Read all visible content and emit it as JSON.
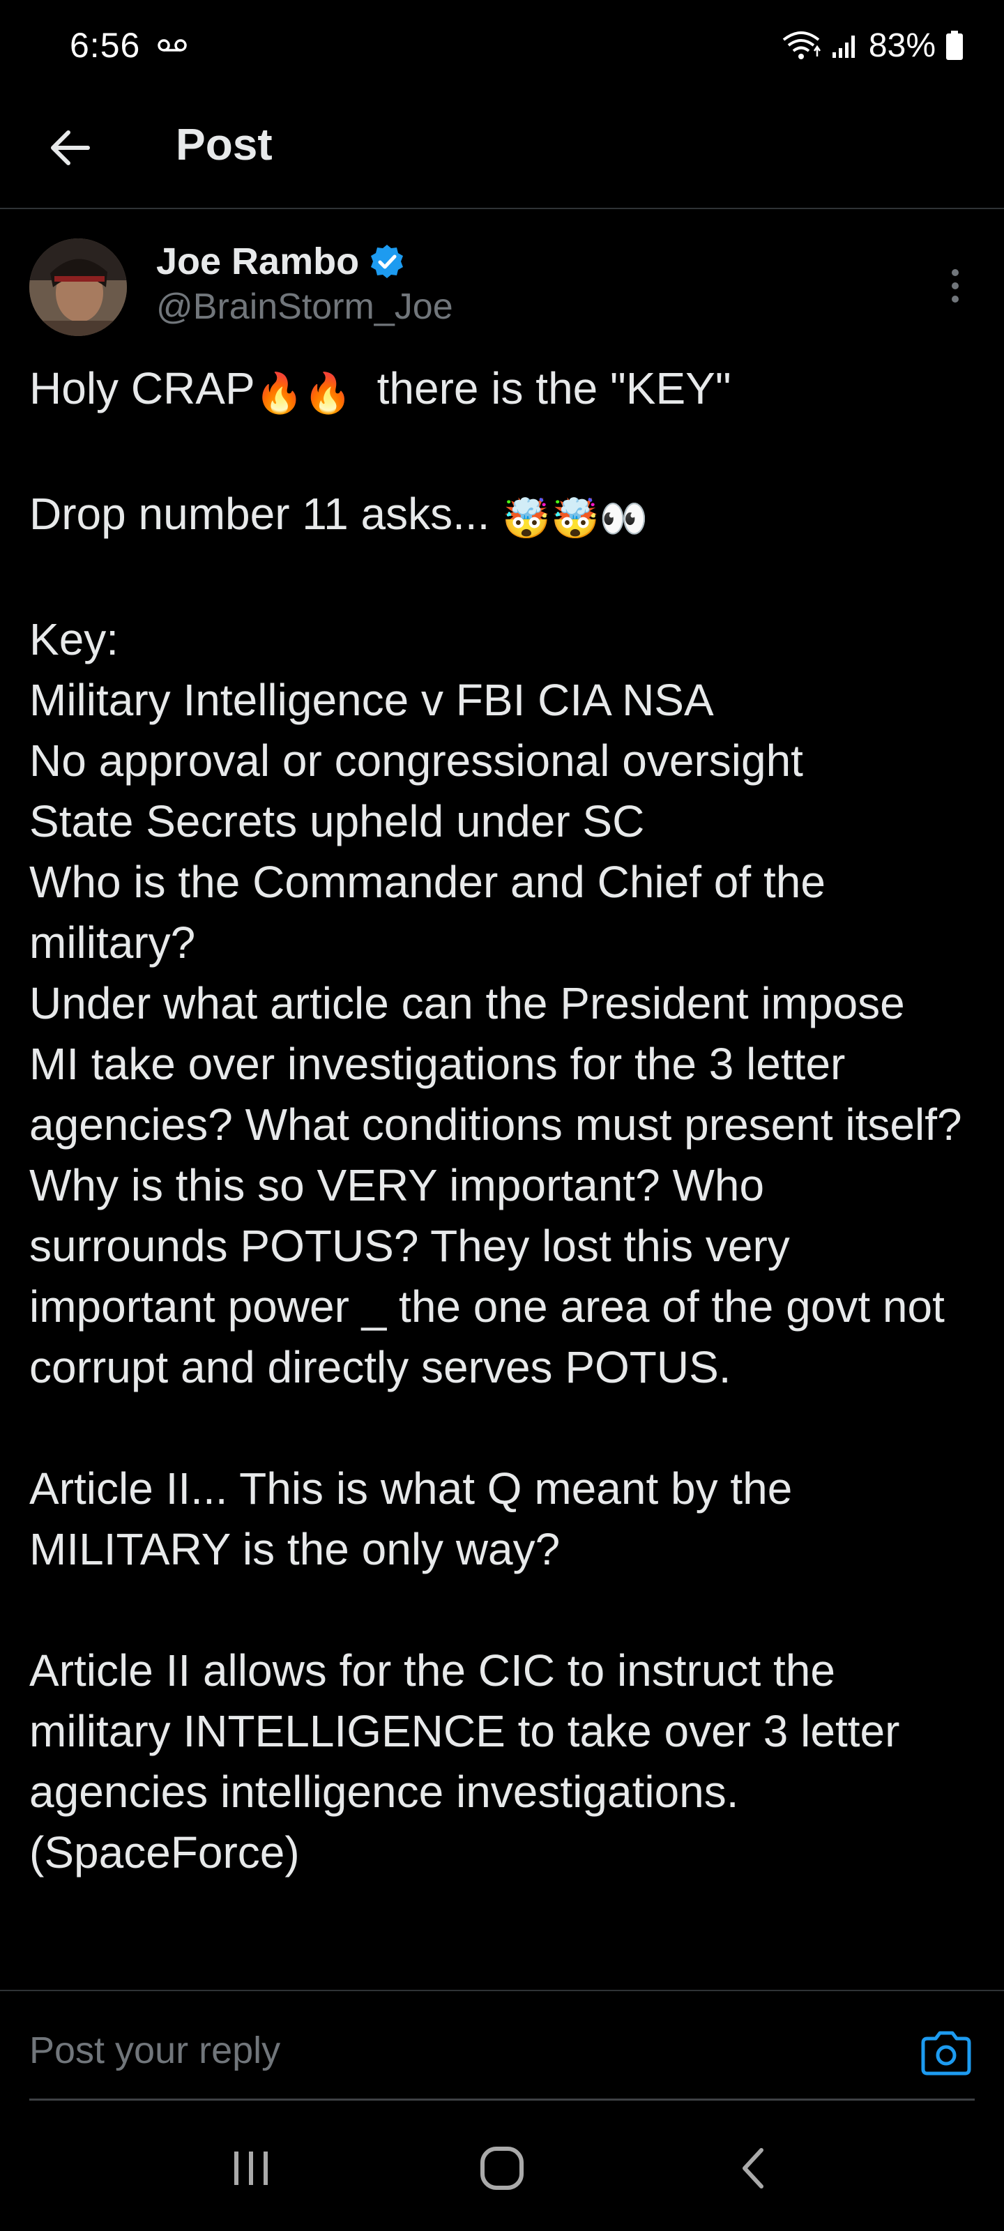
{
  "status_bar": {
    "time": "6:56",
    "battery_percent": "83%",
    "icons": [
      "voicemail-icon",
      "wifi-icon",
      "signal-icon",
      "battery-icon"
    ]
  },
  "header": {
    "title": "Post",
    "back_icon": "arrow-left-icon"
  },
  "post": {
    "author_name": "Joe Rambo",
    "author_handle": "@BrainStorm_Joe",
    "verified": true,
    "paragraphs": [
      {
        "text": "Holy CRAP",
        "emoji_after": "🔥🔥",
        "text_after": "  there is the \"KEY\""
      },
      {
        "text": "Drop number 11 asks... ",
        "emoji_after": "🤯🤯👀",
        "text_after": ""
      },
      {
        "lines": [
          "Key:",
          "Military Intelligence v FBI CIA NSA",
          "No approval or congressional oversight",
          "State Secrets upheld under SC",
          "Who is the Commander and Chief of the military?",
          "Under what article can the President impose MI take over investigations for the 3 letter agencies? What conditions must present itself? Why is this so VERY important? Who surrounds POTUS? They lost this very important power _ the one area of the govt not corrupt and directly serves POTUS."
        ]
      },
      {
        "text": "Article II... This is what Q meant by the MILITARY is the only way?"
      },
      {
        "text": "Article II allows for the CIC to instruct the military INTELLIGENCE to take over 3 letter agencies intelligence investigations. (SpaceForce)"
      }
    ]
  },
  "reply": {
    "placeholder": "Post your reply",
    "camera_icon": "camera-icon"
  },
  "nav_bar": {
    "items": [
      "recent-apps-icon",
      "home-icon",
      "back-icon"
    ]
  },
  "colors": {
    "background": "#000000",
    "text": "#e7e9ea",
    "secondary_text": "#71767b",
    "accent": "#1d9bf0",
    "divider": "#2f3336"
  }
}
